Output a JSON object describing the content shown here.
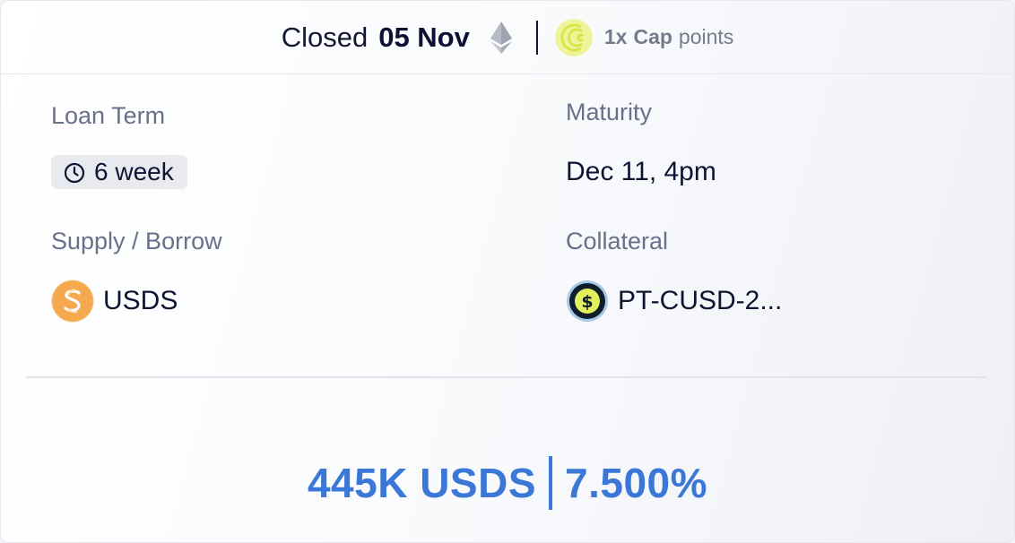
{
  "header": {
    "status_label": "Closed",
    "date": "05 Nov",
    "network_icon": "ethereum-icon",
    "points_icon": "cap-icon",
    "points_multiplier": "1x",
    "points_name": "Cap",
    "points_suffix": "points"
  },
  "details": {
    "loan_term_label": "Loan Term",
    "loan_term_value": "6 week",
    "maturity_label": "Maturity",
    "maturity_value": "Dec 11, 4pm",
    "supply_borrow_label": "Supply / Borrow",
    "supply_token": "USDS",
    "collateral_label": "Collateral",
    "collateral_token": "PT-CUSD-2..."
  },
  "stats": {
    "amount": "445K USDS",
    "rate": "7.500%"
  },
  "colors": {
    "accent": "#3b77d6",
    "cap_yellow": "#e3ef5c",
    "usds_orange": "#f5a94f"
  }
}
